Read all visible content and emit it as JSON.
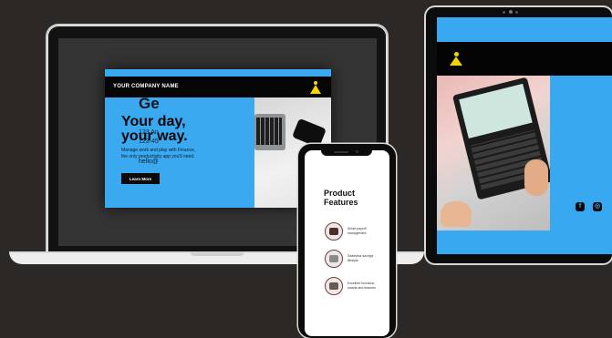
{
  "laptop_site": {
    "company_name": "YOUR COMPANY NAME",
    "headline_1": "Your day,",
    "headline_2": "your way.",
    "sub_1": "Manage work and play with Finance,",
    "sub_2": "the only productivity app you'll need.",
    "cta": "Learn More"
  },
  "phone_site": {
    "title_1": "Product",
    "title_2": "Features",
    "features": [
      {
        "line1": "Smart payroll",
        "line2": "management"
      },
      {
        "line1": "Seamless savings",
        "line2": "lifestyle"
      },
      {
        "line1": "Excellent functions,",
        "line2": "smarts and features"
      }
    ]
  },
  "tablet_site": {
    "heading": "Ge",
    "line_1": "123 An",
    "line_2": "123-45",
    "line_3": "hello@",
    "social_1": "f",
    "social_2": "◎"
  },
  "colors": {
    "accent_blue": "#38a8f0",
    "logo_yellow": "#f4d400",
    "background": "#2b2826"
  }
}
